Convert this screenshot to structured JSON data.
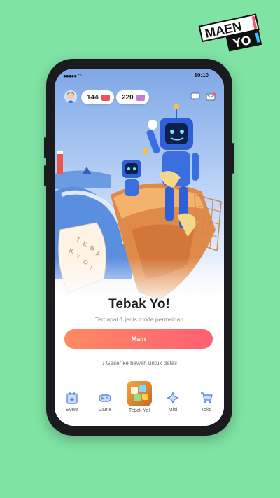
{
  "brand": {
    "line1": "MAEN",
    "line2": "YO"
  },
  "status_bar": {
    "time": "10:10"
  },
  "currency": {
    "tickets_red": "144",
    "tickets_purple": "220"
  },
  "game": {
    "title": "Tebak Yo!",
    "subtitle": "Terdapat 1 jenis mode permainan",
    "play_label": "Main",
    "scroll_hint": "Geser ke bawah untuk detail",
    "tile_letters": [
      "T",
      "E",
      "B",
      "A",
      "K",
      "Y",
      "O",
      "!"
    ]
  },
  "bottom_nav": {
    "items": [
      {
        "label": "Event",
        "icon": "event-icon"
      },
      {
        "label": "Game",
        "icon": "gamepad-icon"
      },
      {
        "label": "Tebak Yo!",
        "icon": "tebak-yo-icon"
      },
      {
        "label": "Misi",
        "icon": "sparkle-icon"
      },
      {
        "label": "Toko",
        "icon": "cart-icon"
      }
    ]
  },
  "colors": {
    "background": "#7fe3a4",
    "accent_start": "#ff8a63",
    "accent_end": "#ff5f72",
    "nav_icon": "#5b8de0"
  }
}
